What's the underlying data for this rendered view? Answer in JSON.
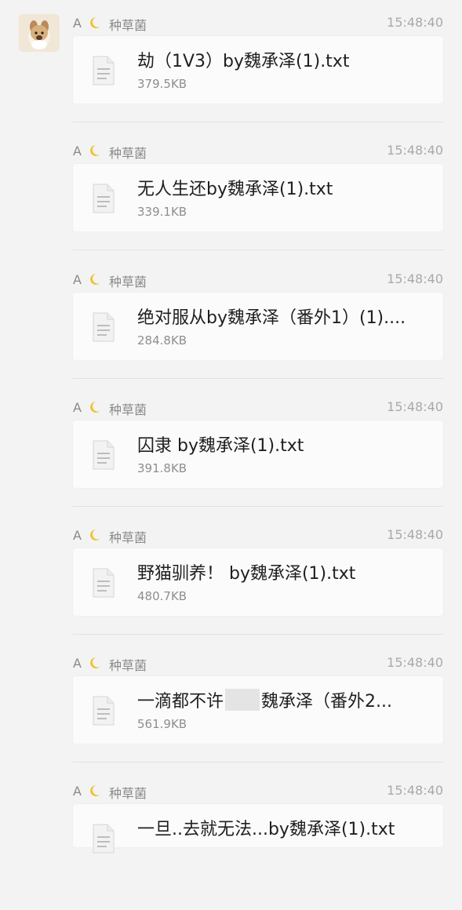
{
  "messages": [
    {
      "initial": "A",
      "sender": "种草菌",
      "time": "15:48:40",
      "file_name": "劫（1V3）by魏承泽(1).txt",
      "file_size": "379.5KB"
    },
    {
      "initial": "A",
      "sender": "种草菌",
      "time": "15:48:40",
      "file_name": "无人生还by魏承泽(1).txt",
      "file_size": "339.1KB"
    },
    {
      "initial": "A",
      "sender": "种草菌",
      "time": "15:48:40",
      "file_name": "绝对服从by魏承泽（番外1）(1)....",
      "file_size": "284.8KB"
    },
    {
      "initial": "A",
      "sender": "种草菌",
      "time": "15:48:40",
      "file_name": "囚隶 by魏承泽(1).txt",
      "file_size": "391.8KB"
    },
    {
      "initial": "A",
      "sender": "种草菌",
      "time": "15:48:40",
      "file_name": "野猫驯养！ by魏承泽(1).txt",
      "file_size": "480.7KB"
    },
    {
      "initial": "A",
      "sender": "种草菌",
      "time": "15:48:40",
      "file_name_before": "一滴都不许",
      "file_name_after": "魏承泽（番外2...",
      "file_size": "561.9KB"
    },
    {
      "initial": "A",
      "sender": "种草菌",
      "time": "15:48:40",
      "file_name": "一旦..去就无法...by魏承泽(1).txt",
      "file_size": ""
    }
  ],
  "icons": {
    "avatar": "avatar-dog-photo",
    "sender_badge": "moon-icon",
    "file": "file-icon"
  },
  "colors": {
    "background": "#f3f3f3",
    "card": "#fbfbfb",
    "badge": "#f1c232"
  }
}
